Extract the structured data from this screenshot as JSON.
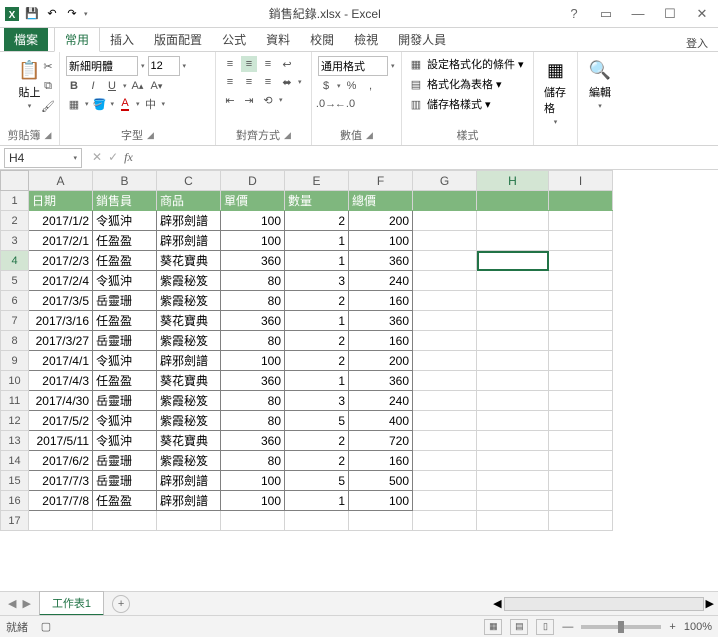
{
  "title": "銷售紀錄.xlsx - Excel",
  "qat": {
    "save": "💾",
    "undo": "↶",
    "redo": "↷"
  },
  "wincontrols": {
    "help": "?",
    "ribbon": "▭",
    "min": "—",
    "max": "☐",
    "close": "✕"
  },
  "tabs": {
    "file": "檔案",
    "list": [
      "常用",
      "插入",
      "版面配置",
      "公式",
      "資料",
      "校閱",
      "檢視",
      "開發人員"
    ],
    "active": 0,
    "signin": "登入"
  },
  "ribbon": {
    "clipboard": {
      "paste": "貼上",
      "label": "剪貼簿"
    },
    "font": {
      "name": "新細明體",
      "size": "12",
      "label": "字型"
    },
    "align": {
      "label": "對齊方式"
    },
    "number": {
      "format": "通用格式",
      "label": "數值"
    },
    "styles": {
      "cf": "設定格式化的條件",
      "tbl": "格式化為表格",
      "cell": "儲存格樣式",
      "label": "樣式"
    },
    "cells": {
      "label": "儲存格"
    },
    "editing": {
      "label": "編輯"
    }
  },
  "namebox": "H4",
  "formula": "",
  "columns": [
    "A",
    "B",
    "C",
    "D",
    "E",
    "F",
    "G",
    "H",
    "I"
  ],
  "selectedCol": "H",
  "selectedRow": 4,
  "chart_data": {
    "type": "table",
    "headers": [
      "日期",
      "銷售員",
      "商品",
      "單價",
      "數量",
      "總價"
    ],
    "rows": [
      [
        "2017/1/2",
        "令狐沖",
        "辟邪劍譜",
        "100",
        "2",
        "200"
      ],
      [
        "2017/2/1",
        "任盈盈",
        "辟邪劍譜",
        "100",
        "1",
        "100"
      ],
      [
        "2017/2/3",
        "任盈盈",
        "葵花寶典",
        "360",
        "1",
        "360"
      ],
      [
        "2017/2/4",
        "令狐沖",
        "紫霞秘笈",
        "80",
        "3",
        "240"
      ],
      [
        "2017/3/5",
        "岳靈珊",
        "紫霞秘笈",
        "80",
        "2",
        "160"
      ],
      [
        "2017/3/16",
        "任盈盈",
        "葵花寶典",
        "360",
        "1",
        "360"
      ],
      [
        "2017/3/27",
        "岳靈珊",
        "紫霞秘笈",
        "80",
        "2",
        "160"
      ],
      [
        "2017/4/1",
        "令狐沖",
        "辟邪劍譜",
        "100",
        "2",
        "200"
      ],
      [
        "2017/4/3",
        "任盈盈",
        "葵花寶典",
        "360",
        "1",
        "360"
      ],
      [
        "2017/4/30",
        "岳靈珊",
        "紫霞秘笈",
        "80",
        "3",
        "240"
      ],
      [
        "2017/5/2",
        "令狐沖",
        "紫霞秘笈",
        "80",
        "5",
        "400"
      ],
      [
        "2017/5/11",
        "令狐沖",
        "葵花寶典",
        "360",
        "2",
        "720"
      ],
      [
        "2017/6/2",
        "岳靈珊",
        "紫霞秘笈",
        "80",
        "2",
        "160"
      ],
      [
        "2017/7/3",
        "岳靈珊",
        "辟邪劍譜",
        "100",
        "5",
        "500"
      ],
      [
        "2017/7/8",
        "任盈盈",
        "辟邪劍譜",
        "100",
        "1",
        "100"
      ]
    ]
  },
  "sheet": {
    "name": "工作表1"
  },
  "status": {
    "ready": "就緒",
    "zoom": "100%"
  }
}
